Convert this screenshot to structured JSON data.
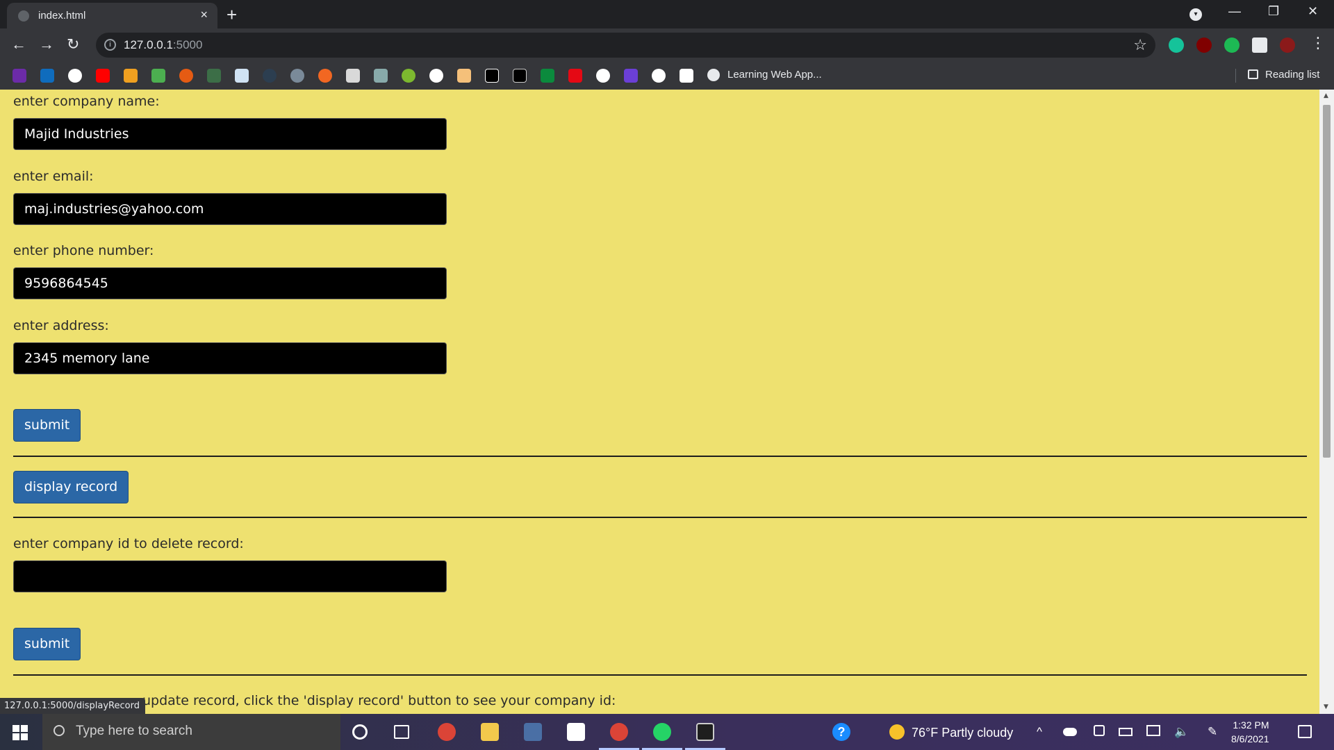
{
  "browser": {
    "tab_title": "index.html",
    "tab_close": "×",
    "new_tab": "+",
    "url_host": "127.0.0.1",
    "url_port": ":5000",
    "bookmark_label": "Learning Web App...",
    "reading_list": "Reading list",
    "minimize": "—",
    "maximize": "❐",
    "close": "✕",
    "back": "←",
    "forward": "→",
    "reload": "↻",
    "star": "☆",
    "menu": "⋮",
    "profile_dd": "▾"
  },
  "form": {
    "company_label": "enter company name:",
    "company_value": "Majid Industries",
    "email_label": "enter email:",
    "email_value": "maj.industries@yahoo.com",
    "phone_label": "enter phone number:",
    "phone_value": "9596864545",
    "address_label": "enter address:",
    "address_value": "2345 memory lane",
    "submit_label": "submit"
  },
  "display": {
    "button_label": "display record"
  },
  "delete_section": {
    "label": "enter company id to delete record:",
    "value": "",
    "submit_label": "submit"
  },
  "update_section": {
    "label": "update record, click the 'display record' button to see your company id:"
  },
  "status_bar": {
    "url": "127.0.0.1:5000/displayRecord"
  },
  "taskbar": {
    "search_placeholder": "Type here to search",
    "weather": "76°F  Partly cloudy",
    "time": "1:32 PM",
    "date": "8/6/2021",
    "tray_up": "^",
    "help": "?"
  },
  "colors": {
    "page_background": "#eee170",
    "input_background": "#000000",
    "button_background": "#2b67a6"
  },
  "icons": [
    "search-icon",
    "chrome-icon",
    "whatsapp-icon",
    "file-explorer-icon",
    "calculator-icon",
    "store-icon"
  ]
}
